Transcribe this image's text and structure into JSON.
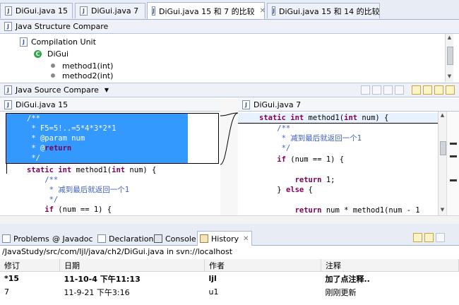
{
  "editor_tabs": [
    {
      "label": "DiGui.java 15"
    },
    {
      "label": "DiGui.java 7"
    },
    {
      "label": "DiGui.java 15 和 7 的比较"
    },
    {
      "label": "DiGui.java 15 和 14 的比较"
    }
  ],
  "structure": {
    "title": "Java Structure Compare",
    "items": [
      {
        "label": "Compilation Unit"
      },
      {
        "label": "DiGui"
      },
      {
        "label": "method1(int)"
      },
      {
        "label": "method2(int)"
      }
    ]
  },
  "source_compare": {
    "title": "Java Source Compare",
    "left_title": "DiGui.java 15",
    "right_title": "DiGui.java 7",
    "left_lines": [
      "/**",
      " * F5=5!..=5*4*3*2*1",
      " * @param num",
      " * @return",
      " */",
      "static int method1(int num) {",
      "    /**",
      "     * 减到最后就返回一个1",
      "     */",
      "    if (num == 1) {"
    ],
    "right_lines": [
      "static int method1(int num) {",
      "    /**",
      "     * 减到最后就返回一个1",
      "     */",
      "    if (num == 1) {",
      "",
      "        return 1;",
      "    } else {",
      "",
      "        return num * method1(num - 1"
    ]
  },
  "bottom_tabs": [
    {
      "label": "Problems"
    },
    {
      "label": "@ Javadoc"
    },
    {
      "label": "Declaration"
    },
    {
      "label": "Console"
    },
    {
      "label": "History"
    }
  ],
  "history": {
    "path": "/JavaStudy/src/com/ljl/java/ch2/DiGui.java in svn://localhost",
    "columns": [
      "修订",
      "日期",
      "作者",
      "注释"
    ],
    "rows": [
      {
        "rev": "*15",
        "date": "11-10-4 下午11:13",
        "author": "ljl",
        "comment": "加了点注释.."
      },
      {
        "rev": "7",
        "date": "11-9-21 下午3:16",
        "author": "u1",
        "comment": "刚刚更新"
      }
    ]
  },
  "colors": {
    "selection": "#3399ff",
    "keyword": "#7f0055",
    "comment": "#3f5fbf"
  }
}
